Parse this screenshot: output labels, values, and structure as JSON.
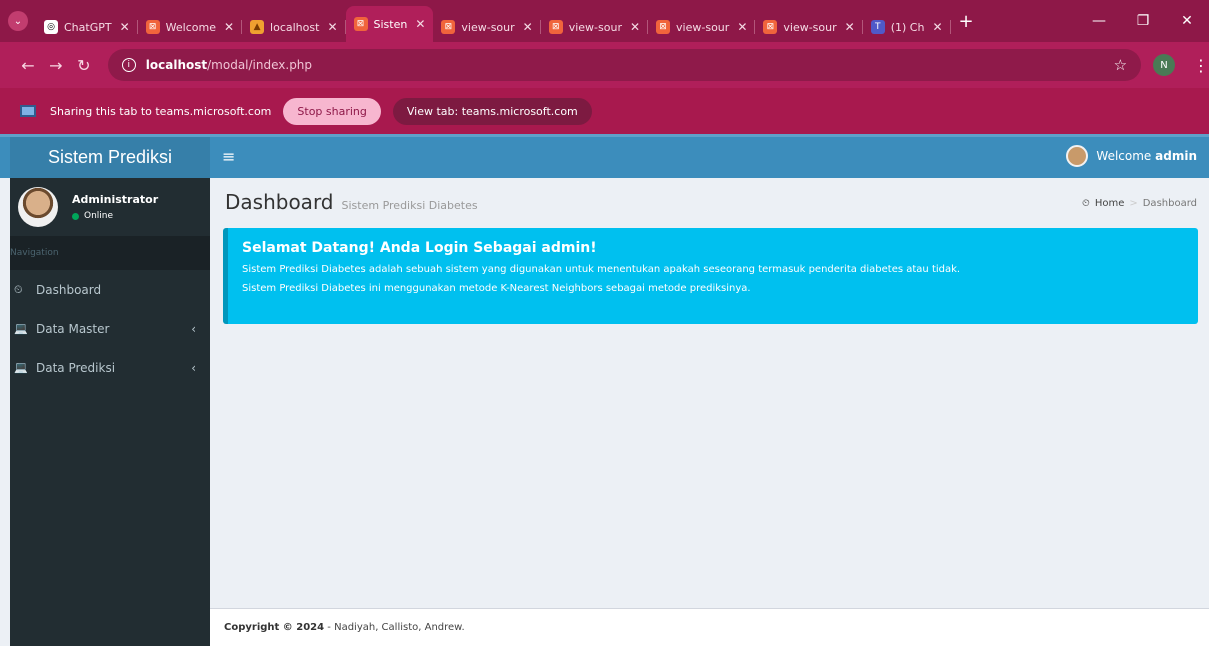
{
  "browser": {
    "tabs": [
      {
        "label": "ChatGPT",
        "favicon_color": "#ffffff",
        "favicon_text_color": "#000000",
        "glyph": "◎"
      },
      {
        "label": "Welcome",
        "favicon_color": "#f0643c",
        "favicon_text_color": "#ffffff",
        "glyph": "⊠"
      },
      {
        "label": "localhost",
        "favicon_color": "#f0a030",
        "favicon_text_color": "#7a3c00",
        "glyph": "▲"
      },
      {
        "label": "Sisten",
        "favicon_color": "#f0643c",
        "favicon_text_color": "#ffffff",
        "glyph": "⊠",
        "active": true
      },
      {
        "label": "view-sour",
        "favicon_color": "#f0643c",
        "favicon_text_color": "#ffffff",
        "glyph": "⊠"
      },
      {
        "label": "view-sour",
        "favicon_color": "#f0643c",
        "favicon_text_color": "#ffffff",
        "glyph": "⊠"
      },
      {
        "label": "view-sour",
        "favicon_color": "#f0643c",
        "favicon_text_color": "#ffffff",
        "glyph": "⊠"
      },
      {
        "label": "view-sour",
        "favicon_color": "#f0643c",
        "favicon_text_color": "#ffffff",
        "glyph": "⊠"
      },
      {
        "label": "(1) Ch",
        "favicon_color": "#5059c9",
        "favicon_text_color": "#ffffff",
        "glyph": "T"
      }
    ],
    "url_host": "localhost",
    "url_path": "/modal/index.php",
    "profile_initial": "N"
  },
  "share_banner": {
    "message": "Sharing this tab to teams.microsoft.com",
    "stop_label": "Stop sharing",
    "view_label": "View tab: teams.microsoft.com"
  },
  "app": {
    "brand": "Sistem Prediksi",
    "welcome_prefix": "Welcome",
    "welcome_user": "admin",
    "user_name": "Administrator",
    "user_status": "Online",
    "nav_header": "Navigation",
    "menu": [
      {
        "label": "Dashboard",
        "icon": "dashboard-icon",
        "glyph": "⏲"
      },
      {
        "label": "Data Master",
        "icon": "laptop-icon",
        "glyph": "💻",
        "has_children": true
      },
      {
        "label": "Data Prediksi",
        "icon": "laptop-icon",
        "glyph": "💻",
        "has_children": true
      }
    ],
    "page_title": "Dashboard",
    "page_subtitle": "Sistem Prediksi Diabetes",
    "breadcrumb": {
      "home": "Home",
      "current": "Dashboard"
    },
    "callout": {
      "title": "Selamat Datang! Anda Login Sebagai admin!",
      "line1": "Sistem Prediksi Diabetes adalah sebuah sistem yang digunakan untuk menentukan apakah seseorang termasuk penderita diabetes atau tidak.",
      "line2": "Sistem Prediksi Diabetes ini menggunakan metode K-Nearest Neighbors sebagai metode prediksinya."
    },
    "footer_copyright": "Copyright © 2024",
    "footer_authors": "- Nadiyah, Callisto, Andrew."
  },
  "colors": {
    "chrome_frame": "#8e1848",
    "share_bar": "#a8194e",
    "header_blue": "#3c8dbc",
    "sidebar_dark": "#222d32",
    "callout_info": "#00c0ef"
  }
}
